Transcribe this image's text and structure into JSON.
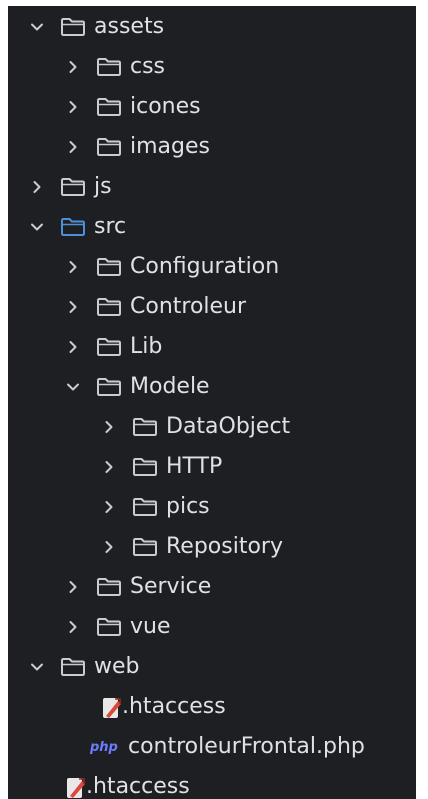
{
  "tree": {
    "rows": [
      {
        "label": "assets",
        "depth": 0,
        "expanded": true,
        "type": "folder",
        "highlight": false
      },
      {
        "label": "css",
        "depth": 1,
        "expanded": false,
        "type": "folder",
        "highlight": false
      },
      {
        "label": "icones",
        "depth": 1,
        "expanded": false,
        "type": "folder",
        "highlight": false
      },
      {
        "label": "images",
        "depth": 1,
        "expanded": false,
        "type": "folder",
        "highlight": false
      },
      {
        "label": "js",
        "depth": 0,
        "expanded": false,
        "type": "folder",
        "highlight": false
      },
      {
        "label": "src",
        "depth": 0,
        "expanded": true,
        "type": "folder",
        "highlight": true
      },
      {
        "label": "Configuration",
        "depth": 1,
        "expanded": false,
        "type": "folder",
        "highlight": false
      },
      {
        "label": "Controleur",
        "depth": 1,
        "expanded": false,
        "type": "folder",
        "highlight": false
      },
      {
        "label": "Lib",
        "depth": 1,
        "expanded": false,
        "type": "folder",
        "highlight": false
      },
      {
        "label": "Modele",
        "depth": 1,
        "expanded": true,
        "type": "folder",
        "highlight": false
      },
      {
        "label": "DataObject",
        "depth": 2,
        "expanded": false,
        "type": "folder",
        "highlight": false
      },
      {
        "label": "HTTP",
        "depth": 2,
        "expanded": false,
        "type": "folder",
        "highlight": false
      },
      {
        "label": "pics",
        "depth": 2,
        "expanded": false,
        "type": "folder",
        "highlight": false
      },
      {
        "label": "Repository",
        "depth": 2,
        "expanded": false,
        "type": "folder",
        "highlight": false
      },
      {
        "label": "Service",
        "depth": 1,
        "expanded": false,
        "type": "folder",
        "highlight": false
      },
      {
        "label": "vue",
        "depth": 1,
        "expanded": false,
        "type": "folder",
        "highlight": false
      },
      {
        "label": "web",
        "depth": 0,
        "expanded": true,
        "type": "folder",
        "highlight": false
      },
      {
        "label": ".htaccess",
        "depth": 1,
        "type": "htaccess"
      },
      {
        "label": "controleurFrontal.php",
        "depth": 1,
        "type": "php",
        "badge": "php"
      },
      {
        "label": ".htaccess",
        "depth": 0,
        "type": "htaccess"
      }
    ]
  },
  "colors": {
    "background": "#1e1f22",
    "text": "#dfe1e5",
    "folder_icon": "#c9ccd3",
    "folder_highlight": "#4e8fd9",
    "chevron": "#c9ccd3",
    "php_badge": "#6b7cff",
    "htaccess_icon": "#d9483b"
  }
}
